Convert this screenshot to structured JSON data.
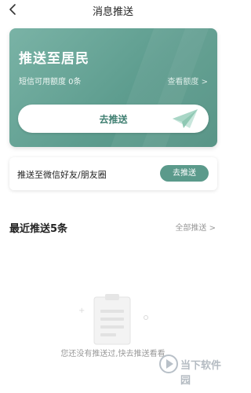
{
  "nav": {
    "title": "消息推送",
    "back_icon": "chevron-left-icon"
  },
  "hero": {
    "title": "推送至居民",
    "quota": "短信可用额度 0条",
    "view_quota": "查看额度 >",
    "cta_label": "去推送",
    "cta_icon": "paper-plane-icon",
    "accent": "#5e9d8f"
  },
  "wechat": {
    "label": "推送至微信好友/朋友圈",
    "button": "去推送",
    "button_color": "#5b9a8b"
  },
  "recent": {
    "title": "最近推送5条",
    "all_link": "全部推送 >"
  },
  "empty": {
    "icon": "clipboard-icon",
    "text": "您还没有推送过,快去推送看看"
  },
  "watermark": {
    "text": "当下软件园",
    "icon": "play-circle-icon"
  }
}
